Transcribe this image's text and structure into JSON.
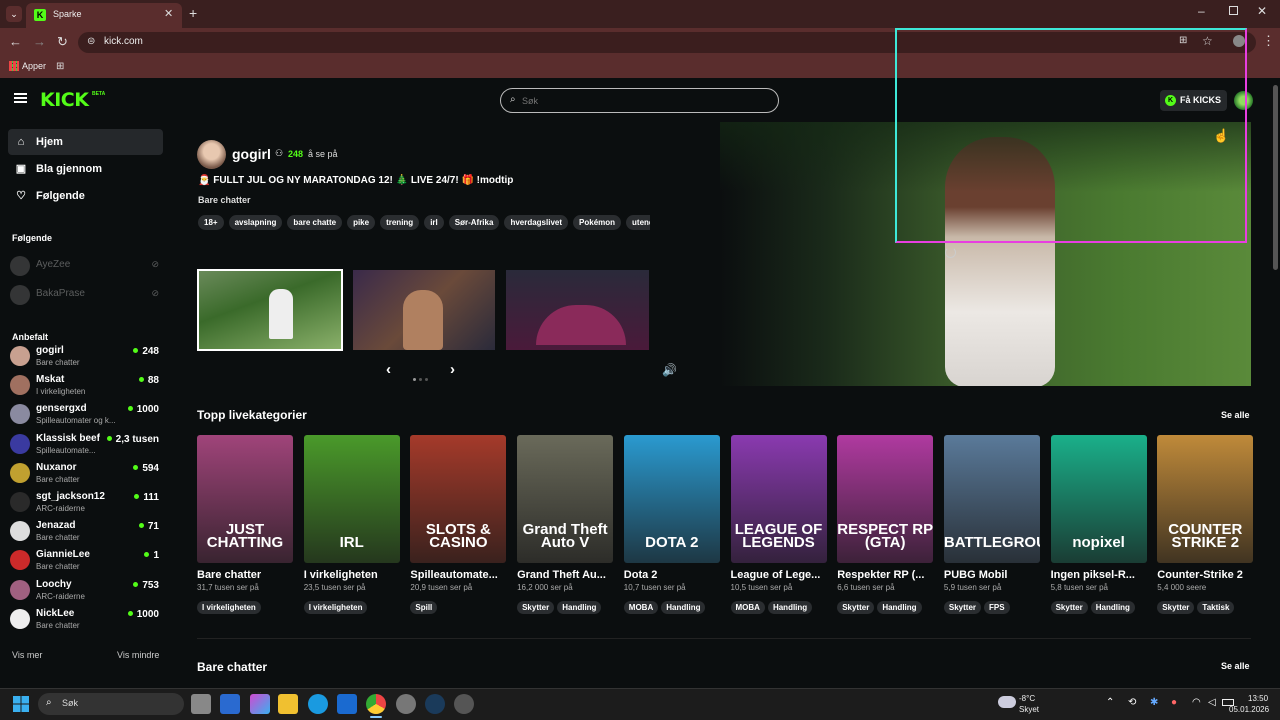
{
  "browser": {
    "tab_title": "Sparke",
    "url": "kick.com",
    "bookmark_label": "Apper"
  },
  "nav": {
    "search_placeholder": "Søk",
    "get_kicks": "Få KICKS",
    "logo_badge": "BETA"
  },
  "sidebar": {
    "menu": [
      {
        "label": "Hjem",
        "icon": "home-icon"
      },
      {
        "label": "Bla gjennom",
        "icon": "browse-icon"
      },
      {
        "label": "Følgende",
        "icon": "heart-icon"
      }
    ],
    "following_title": "Følgende",
    "following": [
      {
        "name": "AyeZee"
      },
      {
        "name": "BakaPrase"
      }
    ],
    "recommended_title": "Anbefalt",
    "recommended": [
      {
        "name": "gogirl",
        "category": "Bare chatter",
        "viewers": "248"
      },
      {
        "name": "Mskat",
        "category": "I virkeligheten",
        "viewers": "88"
      },
      {
        "name": "gensergxd",
        "category": "Spilleautomater og k...",
        "viewers": "1000"
      },
      {
        "name": "Klassisk beef",
        "category": "Spilleautomate...",
        "viewers": "2,3 tusen"
      },
      {
        "name": "Nuxanor",
        "category": "Bare chatter",
        "viewers": "594"
      },
      {
        "name": "sgt_jackson12",
        "category": "ARC-raiderne",
        "viewers": "111"
      },
      {
        "name": "Jenazad",
        "category": "Bare chatter",
        "viewers": "71"
      },
      {
        "name": "GiannieLee",
        "category": "Bare chatter",
        "viewers": "1"
      },
      {
        "name": "Loochy",
        "category": "ARC-raiderne",
        "viewers": "753"
      },
      {
        "name": "NickLee",
        "category": "Bare chatter",
        "viewers": "1000"
      }
    ],
    "show_more": "Vis mer",
    "show_less": "Vis mindre"
  },
  "featured": {
    "streamer": "gogirl",
    "viewers": "248",
    "viewers_suffix": "å se på",
    "title": "🎅 FULLT JUL OG NY MARATONDAG 12! 🎄 LIVE 24/7! 🎁 !modtip",
    "category": "Bare chatter",
    "tags": [
      "18+",
      "avslapning",
      "bare chatte",
      "pike",
      "trening",
      "irl",
      "Sør-Afrika",
      "hverdagslivet",
      "Pokémon",
      "utendør"
    ]
  },
  "top_categories": {
    "title": "Topp livekategorier",
    "see_all": "Se alle",
    "items": [
      {
        "title": "Bare chatter",
        "viewers": "31,7 tusen ser på",
        "tags": [
          "I virkeligheten"
        ],
        "art": "JUST CHATTING",
        "color": "#a0447a"
      },
      {
        "title": "I virkeligheten",
        "viewers": "23,5 tusen ser på",
        "tags": [
          "I virkeligheten"
        ],
        "art": "IRL",
        "color": "#4a9a2a"
      },
      {
        "title": "Spilleautomate...",
        "viewers": "20,9 tusen ser på",
        "tags": [
          "Spill"
        ],
        "art": "SLOTS & CASINO",
        "color": "#a53a2a"
      },
      {
        "title": "Grand Theft Au...",
        "viewers": "16,2 000 ser på",
        "tags": [
          "Skytter",
          "Handling"
        ],
        "art": "Grand Theft Auto V",
        "color": "#6a6a5a"
      },
      {
        "title": "Dota 2",
        "viewers": "10,7 tusen ser på",
        "tags": [
          "MOBA",
          "Handling"
        ],
        "art": "DOTA 2",
        "color": "#2a9ad0"
      },
      {
        "title": "League of Lege...",
        "viewers": "10,5 tusen ser på",
        "tags": [
          "MOBA",
          "Handling"
        ],
        "art": "LEAGUE OF LEGENDS",
        "color": "#8a3ab0"
      },
      {
        "title": "Respekter RP (...",
        "viewers": "6,6 tusen ser på",
        "tags": [
          "Skytter",
          "Handling"
        ],
        "art": "RESPECT RP (GTA)",
        "color": "#b03aa0"
      },
      {
        "title": "PUBG Mobil",
        "viewers": "5,9 tusen ser på",
        "tags": [
          "Skytter",
          "FPS"
        ],
        "art": "BATTLEGROUNDS",
        "color": "#5a7a9a"
      },
      {
        "title": "Ingen piksel-R...",
        "viewers": "5,8 tusen ser på",
        "tags": [
          "Skytter",
          "Handling"
        ],
        "art": "nopixel",
        "color": "#1ab08a"
      },
      {
        "title": "Counter-Strike 2",
        "viewers": "5,4 000 seere",
        "tags": [
          "Skytter",
          "Taktisk"
        ],
        "art": "COUNTER STRIKE 2",
        "color": "#c08a3a"
      }
    ]
  },
  "section2": {
    "title": "Bare chatter",
    "see_all": "Se alle"
  },
  "taskbar": {
    "search": "Søk",
    "weather_temp": "-8°C",
    "weather_desc": "Skyet",
    "time": "13:50",
    "date": "05.01.2026"
  }
}
